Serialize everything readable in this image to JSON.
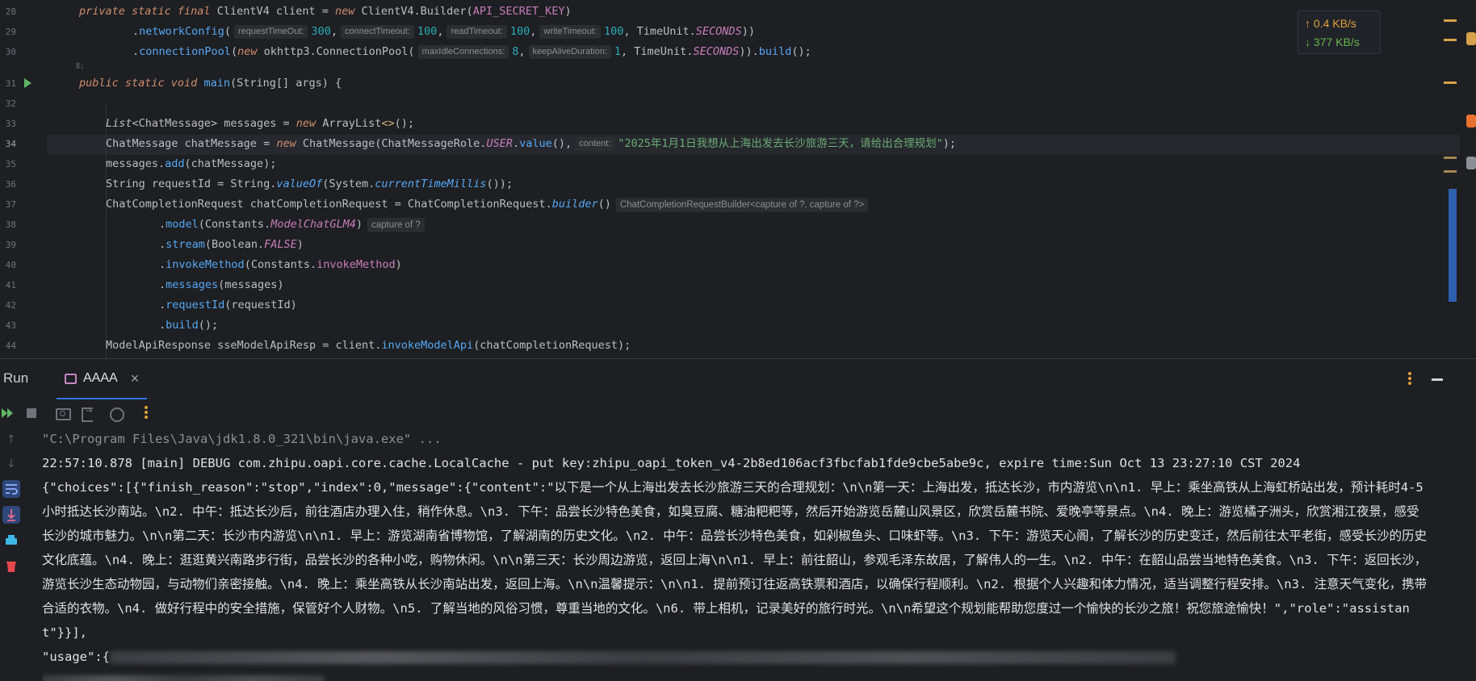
{
  "editor": {
    "line_numbers": [
      "28",
      "29",
      "30",
      "",
      "31",
      "32",
      "33",
      "34",
      "35",
      "36",
      "37",
      "38",
      "39",
      "40",
      "41",
      "42",
      "43",
      "44"
    ],
    "generic_marker": "ʬ↓",
    "lines": {
      "l28": {
        "a": "private static final ",
        "b": "ClientV4 client = ",
        "c": "new ",
        "d": "ClientV4.Builder(",
        "e": "API_SECRET_KEY",
        "f": ")"
      },
      "l29": {
        "a": ".",
        "b": "networkConfig",
        "c": "(",
        "h1": "requestTimeOut:",
        "v1": "300",
        "s1": ",",
        "h2": "connectTimeout:",
        "v2": "100",
        "s2": ",",
        "h3": "readTimeout:",
        "v3": "100",
        "s3": ",",
        "h4": "writeTimeout:",
        "v4": "100",
        "s4": ", TimeUnit.",
        "e": "SECONDS",
        "f": "))"
      },
      "l30": {
        "a": ".",
        "b": "connectionPool",
        "c": "(",
        "d": "new ",
        "e": "okhttp3.ConnectionPool(",
        "h1": "maxIdleConnections:",
        "v1": "8",
        "s1": ",",
        "h2": "keepAliveDuration:",
        "v2": "1",
        "s2": ", TimeUnit.",
        "f": "SECONDS",
        "g": ")).",
        "h": "build",
        "i": "();"
      },
      "l31": {
        "a": "public static void ",
        "b": "main",
        "c": "(String[] args) {"
      },
      "l33": {
        "a": "List",
        "b": "<ChatMessage> messages = ",
        "c": "new ",
        "d": "ArrayList",
        "e": "<>",
        "f": "();"
      },
      "l34": {
        "a": "ChatMessage chatMessage = ",
        "b": "new ",
        "c": "ChatMessage(ChatMessageRole.",
        "d": "USER",
        "e": ".",
        "f": "value",
        "g": "(),",
        "h": "content:",
        "i": "\"2025年1月1日我想从上海出发去长沙旅游三天，请给出合理规划\"",
        "j": ");"
      },
      "l35": {
        "a": "messages.",
        "b": "add",
        "c": "(chatMessage);"
      },
      "l36": {
        "a": "String requestId = String.",
        "b": "valueOf",
        "c": "(System.",
        "d": "currentTimeMillis",
        "e": "());"
      },
      "l37": {
        "a": "ChatCompletionRequest chatCompletionRequest = ChatCompletionRequest.",
        "b": "builder",
        "c": "()",
        "hint": "ChatCompletionRequestBuilder<capture of ?, capture of ?>"
      },
      "l38": {
        "a": ".",
        "b": "model",
        "c": "(Constants.",
        "d": "ModelChatGLM4",
        "e": ")",
        "hint": "capture of ?"
      },
      "l39": {
        "a": ".",
        "b": "stream",
        "c": "(Boolean.",
        "d": "FALSE",
        "e": ")"
      },
      "l40": {
        "a": ".",
        "b": "invokeMethod",
        "c": "(Constants.",
        "d": "invokeMethod",
        "e": ")"
      },
      "l41": {
        "a": ".",
        "b": "messages",
        "c": "(messages)"
      },
      "l42": {
        "a": ".",
        "b": "requestId",
        "c": "(requestId)"
      },
      "l43": {
        "a": ".",
        "b": "build",
        "c": "();"
      },
      "l44": {
        "a": "ModelApiResponse sseModelApiResp = client.",
        "b": "invokeModelApi",
        "c": "(chatCompletionRequest);"
      }
    }
  },
  "network": {
    "upload": "↑ 0.4 KB/s",
    "download": "↓ 377 KB/s"
  },
  "run_panel": {
    "title": "Run",
    "tab_label": "AAAA",
    "tab_close": "×"
  },
  "console": {
    "cmd": "\"C:\\Program Files\\Java\\jdk1.8.0_321\\bin\\java.exe\" ...",
    "debug": "22:57:10.878 [main] DEBUG com.zhipu.oapi.core.cache.LocalCache - put key:zhipu_oapi_token_v4-2b8ed106acf3fbcfab1fde9cbe5abe9c, expire time:Sun Oct 13 23:27:10 CST 2024",
    "response": "{\"choices\":[{\"finish_reason\":\"stop\",\"index\":0,\"message\":{\"content\":\"以下是一个从上海出发去长沙旅游三天的合理规划：\\n\\n第一天：上海出发，抵达长沙，市内游览\\n\\n1. 早上：乘坐高铁从上海虹桥站出发，预计耗时4-5小时抵达长沙南站。\\n2. 中午：抵达长沙后，前往酒店办理入住，稍作休息。\\n3. 下午：品尝长沙特色美食，如臭豆腐、糖油粑粑等，然后开始游览岳麓山风景区，欣赏岳麓书院、爱晚亭等景点。\\n4. 晚上：游览橘子洲头，欣赏湘江夜景，感受长沙的城市魅力。\\n\\n第二天：长沙市内游览\\n\\n1. 早上：游览湖南省博物馆，了解湖南的历史文化。\\n2. 中午：品尝长沙特色美食，如剁椒鱼头、口味虾等。\\n3. 下午：游览天心阁，了解长沙的历史变迁，然后前往太平老街，感受长沙的历史文化底蕴。\\n4. 晚上：逛逛黄兴南路步行街，品尝长沙的各种小吃，购物休闲。\\n\\n第三天：长沙周边游览，返回上海\\n\\n1. 早上：前往韶山，参观毛泽东故居，了解伟人的一生。\\n2. 中午：在韶山品尝当地特色美食。\\n3. 下午：返回长沙，游览长沙生态动物园，与动物们亲密接触。\\n4. 晚上：乘坐高铁从长沙南站出发，返回上海。\\n\\n温馨提示：\\n\\n1. 提前预订往返高铁票和酒店，以确保行程顺利。\\n2. 根据个人兴趣和体力情况，适当调整行程安排。\\n3. 注意天气变化，携带合适的衣物。\\n4. 做好行程中的安全措施，保管好个人财物。\\n5. 了解当地的风俗习惯，尊重当地的文化。\\n6. 带上相机，记录美好的旅行时光。\\n\\n希望这个规划能帮助您度过一个愉快的长沙之旅！祝您旅途愉快！\",\"role\":\"assistant\"}}],",
    "usage_prefix": "\"usage\":{"
  },
  "colors": {
    "accent": "#3574f0",
    "run_green": "#5fb865",
    "warning": "#e2a23b"
  }
}
